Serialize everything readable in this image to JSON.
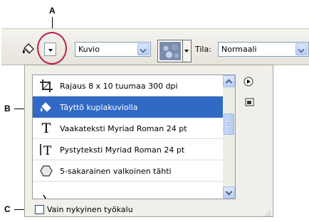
{
  "callouts": {
    "a": "A",
    "b": "B",
    "c": "C"
  },
  "options_bar": {
    "tool_icon": "paint-bucket-icon",
    "fill_source": {
      "selected": "Kuvio"
    },
    "pattern_icon": "bubble-pattern-swatch",
    "mode_label": "Tila:",
    "mode": {
      "selected": "Normaali"
    }
  },
  "preset_panel": {
    "items": [
      {
        "label": "Rajaus 8 x 10 tuumaa 300 dpi",
        "icon": "crop-icon",
        "selected": false
      },
      {
        "label": "Täyttö kuplakuviolla",
        "icon": "paint-bucket-icon",
        "selected": true
      },
      {
        "label": "Vaakateksti Myriad Roman 24 pt",
        "icon": "horizontal-type-icon",
        "selected": false
      },
      {
        "label": "Pystyteksti Myriad Roman 24 pt",
        "icon": "vertical-type-icon",
        "selected": false
      },
      {
        "label": "5-sakarainen valkoinen tähti",
        "icon": "polygon-icon",
        "selected": false
      }
    ],
    "current_tool_only_label": "Vain nykyinen työkalu",
    "current_tool_only_checked": false
  },
  "colors": {
    "selection": "#316ac5",
    "highlight_circle": "#b8204c"
  }
}
